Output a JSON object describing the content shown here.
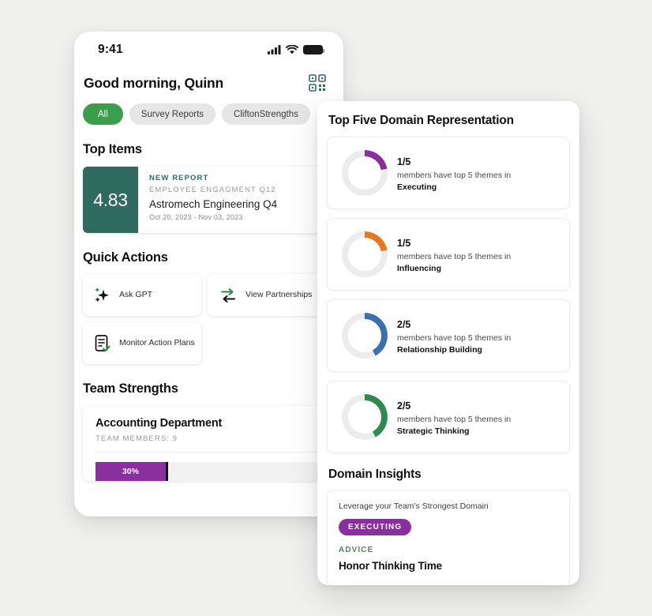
{
  "phone": {
    "status_bar": {
      "time": "9:41",
      "signal_icon": "cellular-signal-icon",
      "wifi_icon": "wifi-icon",
      "battery_icon": "battery-icon"
    },
    "greeting": "Good morning, Quinn",
    "qr_icon": "qr-scan-icon",
    "filters": [
      {
        "label": "All",
        "active": true
      },
      {
        "label": "Survey Reports",
        "active": false
      },
      {
        "label": "CliftonStrengths",
        "active": false
      }
    ],
    "top_items": {
      "title": "Top Items",
      "report": {
        "score": "4.83",
        "tag": "NEW REPORT",
        "survey": "EMPLOYEE ENGAGMENT Q12",
        "name": "Astromech Engineering Q4",
        "date_range": "Oct 20, 2023 - Nov 03, 2023"
      }
    },
    "quick_actions": {
      "title": "Quick Actions",
      "items": [
        {
          "label": "Ask GPT",
          "icon": "sparkle-icon"
        },
        {
          "label": "View Partnerships",
          "icon": "two-arrows-icon"
        },
        {
          "label": "Monitor Action Plans",
          "icon": "document-check-icon"
        }
      ]
    },
    "team_strengths": {
      "title": "Team Strengths",
      "team_name": "Accounting Department",
      "members_label": "TEAM MEMBERS: 9",
      "bar_percent_label": "30%",
      "bar_color": "#8a2f9e"
    }
  },
  "panel": {
    "title": "Top Five Domain Representation",
    "domains": [
      {
        "fraction": "1/5",
        "description": "members have top 5 themes in",
        "domain": "Executing",
        "color": "#8a2f9e",
        "percent": 22
      },
      {
        "fraction": "1/5",
        "description": "members have top 5 themes in",
        "domain": "Influencing",
        "color": "#e87722",
        "percent": 22
      },
      {
        "fraction": "2/5",
        "description": "members have top 5 themes in",
        "domain": "Relationship Building",
        "color": "#3a6fb0",
        "percent": 42
      },
      {
        "fraction": "2/5",
        "description": "members have top 5 themes in",
        "domain": "Strategic Thinking",
        "color": "#2e8b4f",
        "percent": 42
      }
    ],
    "insights": {
      "title": "Domain Insights",
      "lead": "Leverage your Team's Strongest Domain",
      "badge": "EXECUTING",
      "advice_label": "ADVICE",
      "advice": "Honor Thinking Time"
    }
  }
}
